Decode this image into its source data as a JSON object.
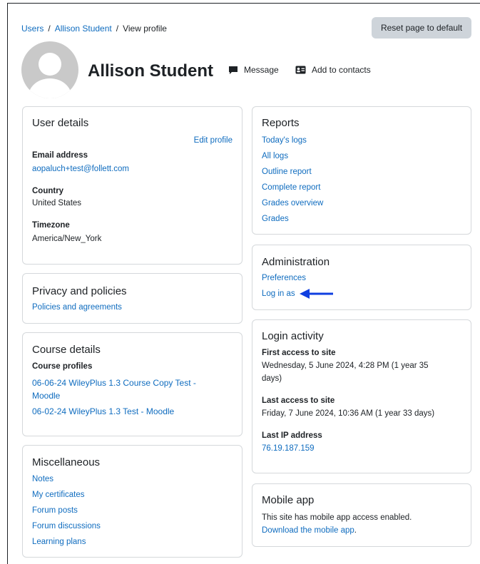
{
  "breadcrumb": {
    "items": [
      "Users",
      "Allison Student"
    ],
    "current": "View profile",
    "separator": "/"
  },
  "reset_button": "Reset page to default",
  "profile": {
    "name": "Allison Student",
    "message_label": "Message",
    "add_contacts_label": "Add to contacts"
  },
  "user_details": {
    "title": "User details",
    "edit_profile": "Edit profile",
    "email_label": "Email address",
    "email_value": "aopaluch+test@follett.com",
    "country_label": "Country",
    "country_value": "United States",
    "timezone_label": "Timezone",
    "timezone_value": "America/New_York"
  },
  "privacy": {
    "title": "Privacy and policies",
    "link": "Policies and agreements"
  },
  "course_details": {
    "title": "Course details",
    "profiles_label": "Course profiles",
    "courses": [
      "06-06-24 WileyPlus 1.3 Course Copy Test -",
      "Moodle",
      "06-02-24 WileyPlus 1.3 Test - Moodle"
    ]
  },
  "misc": {
    "title": "Miscellaneous",
    "items": [
      "Notes",
      "My certificates",
      "Forum posts",
      "Forum discussions",
      "Learning plans"
    ]
  },
  "reports": {
    "title": "Reports",
    "items": [
      "Today's logs",
      "All logs",
      "Outline report",
      "Complete report",
      "Grades overview",
      "Grades"
    ]
  },
  "administration": {
    "title": "Administration",
    "items": [
      "Preferences",
      "Log in as"
    ]
  },
  "login_activity": {
    "title": "Login activity",
    "first_access_label": "First access to site",
    "first_access_value_1": "Wednesday, 5 June 2024, 4:28 PM  (1 year 35",
    "first_access_value_2": "days)",
    "last_access_label": "Last access to site",
    "last_access_value": "Friday, 7 June 2024, 10:36 AM  (1 year 33 days)",
    "last_ip_label": "Last IP address",
    "last_ip_value": "76.19.187.159"
  },
  "mobile_app": {
    "title": "Mobile app",
    "text": "This site has mobile app access enabled.",
    "link": "Download the mobile app",
    "link_suffix": "."
  },
  "colors": {
    "link": "#0f6cbf",
    "text": "#1d2125",
    "button_bg": "#ced4da",
    "card_border": "#d5d8db",
    "arrow": "#0f3fe0"
  }
}
